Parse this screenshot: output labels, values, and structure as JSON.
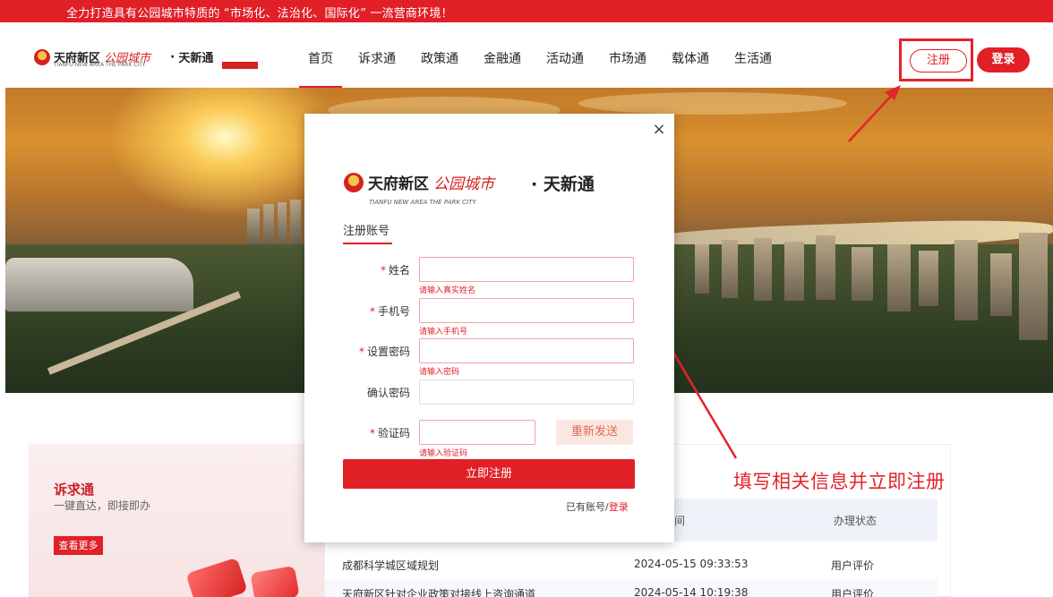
{
  "banner": {
    "text": "全力打造具有公园城市特质的 “市场化、法治化、国际化” 一流营商环境！"
  },
  "header": {
    "brand_cn": "天府新区",
    "brand_red": "公园城市",
    "brand_sub": "TIANFU NEW AREA THE PARK CITY",
    "separator": "·",
    "product": "天新通",
    "nav": [
      "首页",
      "诉求通",
      "政策通",
      "金融通",
      "活动通",
      "市场通",
      "载体通",
      "生活通"
    ],
    "register_label": "注册",
    "login_label": "登录"
  },
  "card": {
    "title": "诉求通",
    "subtitle": "一键直达，即接即办",
    "more_label": "查看更多"
  },
  "table": {
    "headers": [
      "时间",
      "办理状态"
    ],
    "rows": [
      {
        "name": "成都科学城区域规划",
        "time": "2024-05-15 09:33:53",
        "status": "用户评价"
      },
      {
        "name": "天府新区针对企业政策对接线上咨询通道",
        "time": "2024-05-14 10:19:38",
        "status": "用户评价"
      }
    ]
  },
  "annotation": "填写相关信息并立即注册",
  "modal": {
    "close_label": "×",
    "brand_cn": "天府新区",
    "brand_red": "公园城市",
    "brand_sub": "TIANFU NEW AREA THE PARK CITY",
    "separator": "·",
    "product": "天新通",
    "tab": "注册账号",
    "required_mark": "*",
    "fields": {
      "name": {
        "label": "姓名",
        "error": "请输入真实姓名"
      },
      "phone": {
        "label": "手机号",
        "error": "请输入手机号"
      },
      "password": {
        "label": "设置密码",
        "error": "请输入密码"
      },
      "confirm": {
        "label": "确认密码"
      },
      "code": {
        "label": "验证码",
        "error": "请输入验证码",
        "resend_label": "重新发送"
      }
    },
    "submit_label": "立即注册",
    "have_account": "已有账号/",
    "login_link": "登录"
  },
  "colors": {
    "brand_red": "#e11f27",
    "annotation_red": "#e4232b"
  }
}
